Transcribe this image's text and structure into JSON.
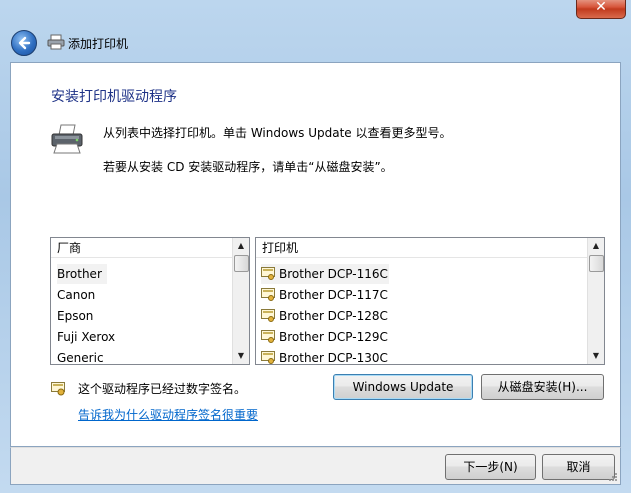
{
  "window": {
    "title": "添加打印机",
    "close_glyph": "✕"
  },
  "page": {
    "heading": "安装打印机驱动程序",
    "desc1": "从列表中选择打印机。单击 Windows Update 以查看更多型号。",
    "desc2": "若要从安装 CD 安装驱动程序，请单击“从磁盘安装”。"
  },
  "manufacturers": {
    "header": "厂商",
    "items": [
      "Brother",
      "Canon",
      "Epson",
      "Fuji Xerox",
      "Generic"
    ],
    "selected": "Brother"
  },
  "printers": {
    "header": "打印机",
    "items": [
      "Brother DCP-116C",
      "Brother DCP-117C",
      "Brother DCP-128C",
      "Brother DCP-129C",
      "Brother DCP-130C"
    ],
    "selected": "Brother DCP-116C"
  },
  "signature": {
    "text": "这个驱动程序已经过数字签名。",
    "link": "告诉我为什么驱动程序签名很重要"
  },
  "buttons": {
    "windows_update": "Windows Update",
    "have_disk": "从磁盘安装(H)...",
    "next": "下一步(N)",
    "cancel": "取消"
  },
  "icons": {
    "back": "back-arrow-icon",
    "printer": "printer-icon",
    "driver": "signed-driver-icon"
  },
  "colors": {
    "heading": "#1e3287",
    "link": "#0066cc",
    "frame": "#a9c8e6"
  }
}
